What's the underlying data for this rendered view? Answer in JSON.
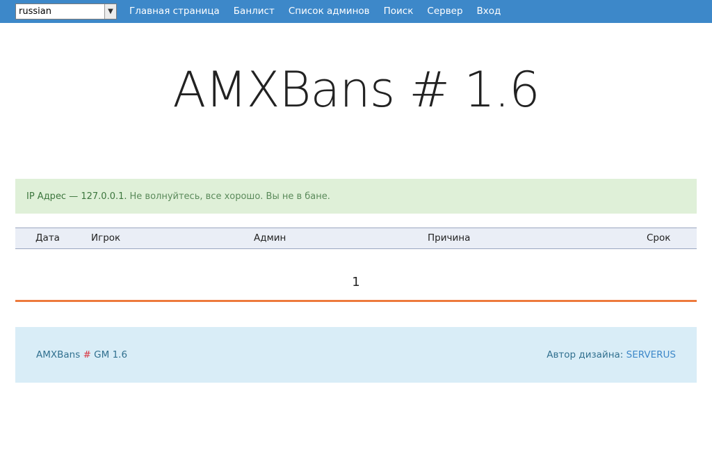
{
  "language_select": {
    "value": "russian"
  },
  "nav": {
    "items": [
      {
        "label": "Главная страница"
      },
      {
        "label": "Банлист"
      },
      {
        "label": "Список админов"
      },
      {
        "label": "Поиск"
      },
      {
        "label": "Сервер"
      },
      {
        "label": "Вход"
      }
    ]
  },
  "header": {
    "title": "AMXBans # 1.6"
  },
  "alert": {
    "ip_label": "IP Адрес — 127.0.0.1.",
    "message": "Не волнуйтесь, все хорошо. Вы не в бане."
  },
  "table": {
    "columns": [
      "Дата",
      "Игрок",
      "Админ",
      "Причина",
      "Срок"
    ]
  },
  "pagination": {
    "current_page": "1"
  },
  "footer": {
    "left_prefix": "AMXBans",
    "left_hash": "#",
    "left_suffix": "GM 1.6",
    "right_label": "Автор дизайна:",
    "right_link": "SERVERUS"
  },
  "colors": {
    "topbar": "#3d88c9",
    "alert_bg": "#dff0d8",
    "footer_bg": "#d9edf7",
    "accent_line": "#ed7a3c"
  }
}
